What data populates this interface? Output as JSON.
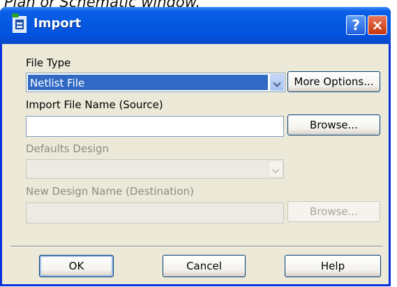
{
  "caption": "Plan or Schematic window.",
  "window": {
    "title": "Import",
    "help_button": "?",
    "close_button": "×"
  },
  "file_type": {
    "label": "File Type",
    "selected": "Netlist File",
    "more_options": "More Options..."
  },
  "import_file": {
    "label": "Import File Name (Source)",
    "value": "",
    "browse": "Browse..."
  },
  "defaults_design": {
    "label": "Defaults Design",
    "value": ""
  },
  "new_design": {
    "label": "New Design Name (Destination)",
    "value": "",
    "browse": "Browse..."
  },
  "footer": {
    "ok": "OK",
    "cancel": "Cancel",
    "help": "Help"
  },
  "colors": {
    "titlebar": "#0458e0",
    "dialog_bg": "#ece9d8",
    "selection": "#316ac5"
  }
}
